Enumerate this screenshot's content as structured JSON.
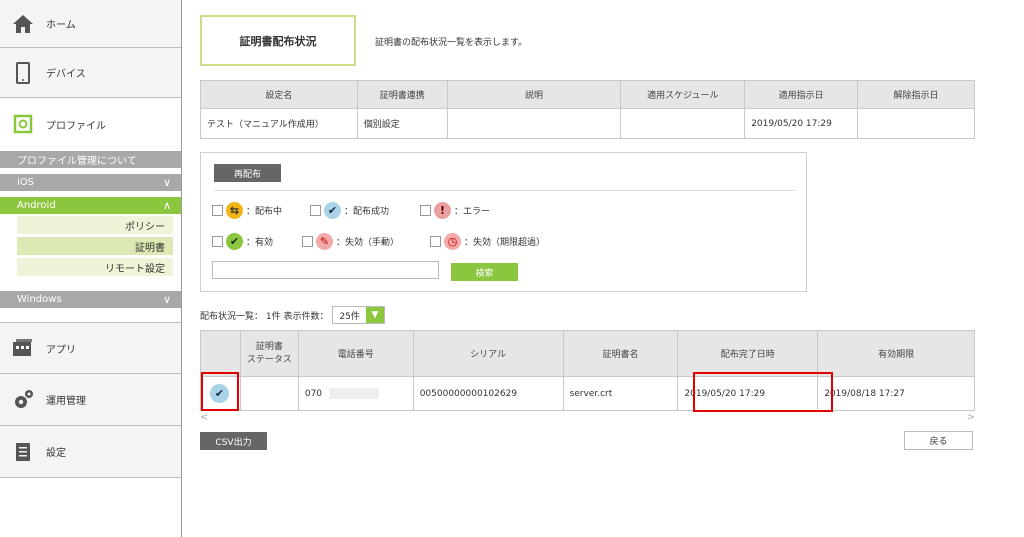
{
  "sidebar": {
    "home": "ホーム",
    "device": "デバイス",
    "profile": "プロファイル",
    "profile_about": "プロファイル管理について",
    "ios": "iOS",
    "android": "Android",
    "android_items": [
      "ポリシー",
      "証明書",
      "リモート設定"
    ],
    "windows": "Windows",
    "app": "アプリ",
    "ops": "運用管理",
    "settings": "設定"
  },
  "page": {
    "title": "証明書配布状況",
    "description": "証明書の配布状況一覧を表示します。"
  },
  "info_table": {
    "headers": [
      "設定名",
      "証明書連携",
      "説明",
      "適用スケジュール",
      "適用指示日",
      "解除指示日"
    ],
    "row": [
      "テスト（マニュアル作成用）",
      "個別設定",
      "",
      "",
      "2019/05/20 17:29",
      ""
    ]
  },
  "filter": {
    "redistribute_label": "再配布",
    "statuses_row1": [
      {
        "label": "：配布中",
        "icon": "distributing-icon"
      },
      {
        "label": "：配布成功",
        "icon": "success-icon"
      },
      {
        "label": "：エラー",
        "icon": "error-icon"
      }
    ],
    "statuses_row2": [
      {
        "label": "：有効",
        "icon": "valid-icon"
      },
      {
        "label": "：失効（手動）",
        "icon": "revoked-manual-icon"
      },
      {
        "label": "：失効（期限超過）",
        "icon": "revoked-expired-icon"
      }
    ],
    "search_placeholder": "",
    "search_label": "検索"
  },
  "list": {
    "summary": "配布状況一覧： 1件 表示件数：",
    "per_page": "25件",
    "headers": [
      "",
      "証明書\nステータス",
      "電話番号",
      "シリアル",
      "証明書名",
      "配布完了日時",
      "有効期限"
    ],
    "rows": [
      {
        "phone": "070",
        "serial": "00500000000102629",
        "cert_name": "server.crt",
        "completed": "2019/05/20 17:29",
        "expiry": "2019/08/18 17:27"
      }
    ]
  },
  "buttons": {
    "csv": "CSV出力",
    "back": "戻る"
  },
  "colors": {
    "accent_green": "#8cc63f",
    "highlight_red": "#e00000"
  }
}
